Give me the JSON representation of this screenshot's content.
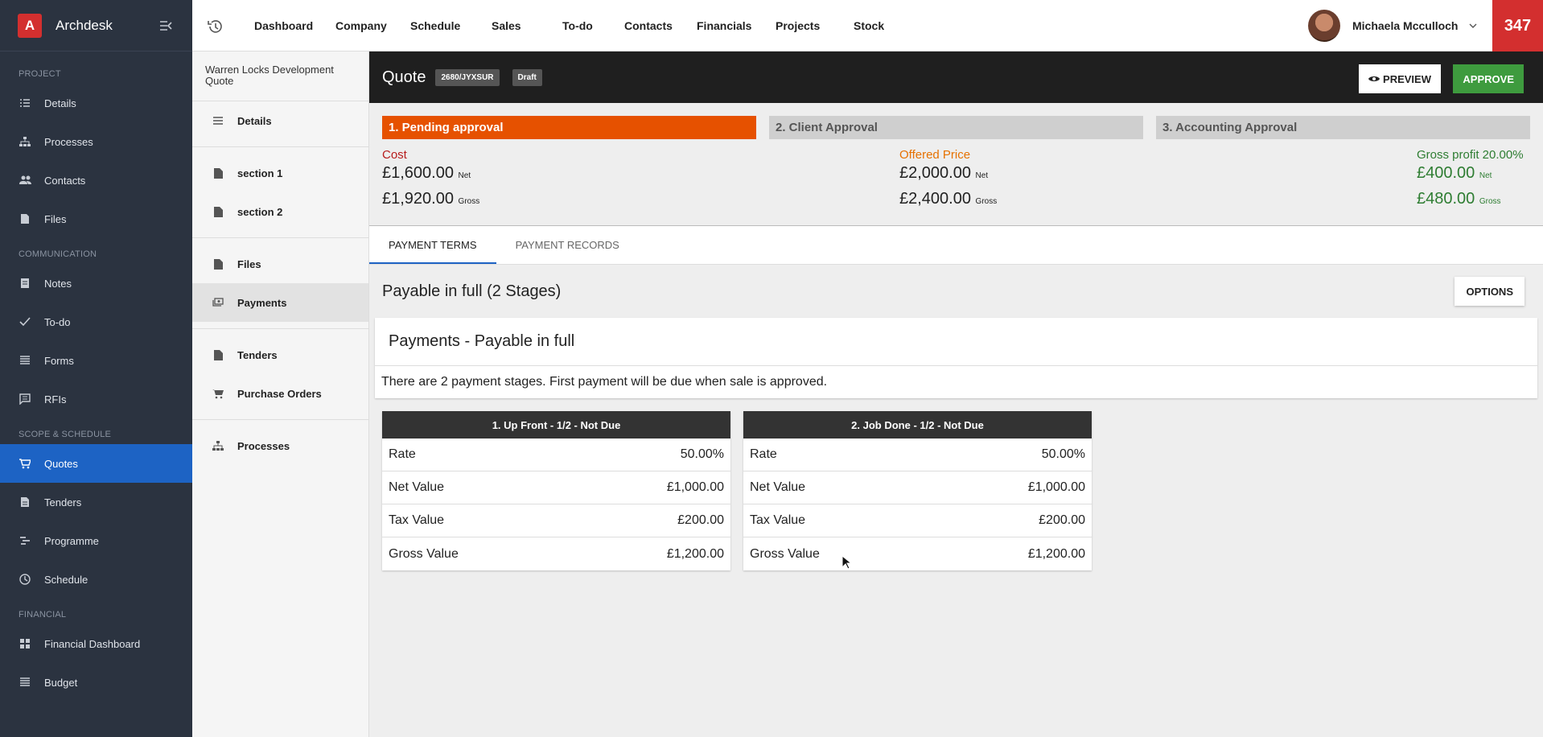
{
  "brand": {
    "logo_letter": "A",
    "name": "Archdesk"
  },
  "sidebar": {
    "sections": [
      {
        "title": "PROJECT",
        "items": [
          {
            "label": "Details",
            "icon": "list-icon"
          },
          {
            "label": "Processes",
            "icon": "hierarchy-icon"
          },
          {
            "label": "Contacts",
            "icon": "people-icon"
          },
          {
            "label": "Files",
            "icon": "file-icon"
          }
        ]
      },
      {
        "title": "COMMUNICATION",
        "items": [
          {
            "label": "Notes",
            "icon": "note-icon"
          },
          {
            "label": "To-do",
            "icon": "check-icon"
          },
          {
            "label": "Forms",
            "icon": "form-icon"
          },
          {
            "label": "RFIs",
            "icon": "rfi-icon"
          }
        ]
      },
      {
        "title": "SCOPE & SCHEDULE",
        "items": [
          {
            "label": "Quotes",
            "icon": "cart-icon",
            "active": true
          },
          {
            "label": "Tenders",
            "icon": "document-icon"
          },
          {
            "label": "Programme",
            "icon": "gantt-icon"
          },
          {
            "label": "Schedule",
            "icon": "clock-icon"
          }
        ]
      },
      {
        "title": "FINANCIAL",
        "items": [
          {
            "label": "Financial Dashboard",
            "icon": "dashboard-icon"
          },
          {
            "label": "Budget",
            "icon": "budget-icon"
          }
        ]
      }
    ]
  },
  "topnav": {
    "items": [
      "Dashboard",
      "Company",
      "Schedule",
      "Sales",
      "To-do",
      "Contacts",
      "Financials",
      "Projects",
      "Stock"
    ],
    "user_name": "Michaela Mcculloch",
    "notification_count": "347"
  },
  "submenu": {
    "title": "Warren Locks Development Quote",
    "items": [
      {
        "label": "Details",
        "icon": "list-icon"
      },
      {
        "label": "section 1",
        "icon": "document-icon"
      },
      {
        "label": "section 2",
        "icon": "document-icon"
      },
      {
        "label": "Files",
        "icon": "file-icon"
      },
      {
        "label": "Payments",
        "icon": "payment-icon",
        "active": true
      },
      {
        "label": "Tenders",
        "icon": "document-icon"
      },
      {
        "label": "Purchase Orders",
        "icon": "cart-icon"
      },
      {
        "label": "Processes",
        "icon": "hierarchy-icon"
      }
    ]
  },
  "quote": {
    "title": "Quote",
    "code": "2680/JYXSUR",
    "status": "Draft",
    "preview_label": "PREVIEW",
    "approve_label": "APPROVE"
  },
  "stages": [
    {
      "label": "1. Pending approval",
      "current": true
    },
    {
      "label": "2. Client Approval",
      "current": false
    },
    {
      "label": "3. Accounting Approval",
      "current": false
    }
  ],
  "totals": {
    "cost": {
      "label": "Cost",
      "net": "£1,600.00",
      "gross": "£1,920.00"
    },
    "offered": {
      "label": "Offered Price",
      "net": "£2,000.00",
      "gross": "£2,400.00"
    },
    "profit": {
      "label": "Gross profit 20.00%",
      "net": "£400.00",
      "gross": "£480.00"
    },
    "net_suffix": "Net",
    "gross_suffix": "Gross"
  },
  "tabs": [
    {
      "label": "PAYMENT TERMS",
      "active": true
    },
    {
      "label": "PAYMENT RECORDS",
      "active": false
    }
  ],
  "plan": {
    "title": "Payable in full (2 Stages)",
    "options_label": "OPTIONS",
    "card_title": "Payments - Payable in full",
    "description": "There are 2 payment stages. First payment will be due when sale is approved."
  },
  "payment_stages": [
    {
      "title": "1. Up Front - 1/2 - Not Due",
      "rows": [
        {
          "label": "Rate",
          "value": "50.00%"
        },
        {
          "label": "Net Value",
          "value": "£1,000.00"
        },
        {
          "label": "Tax Value",
          "value": "£200.00"
        },
        {
          "label": "Gross Value",
          "value": "£1,200.00"
        }
      ]
    },
    {
      "title": "2. Job Done - 1/2 - Not Due",
      "rows": [
        {
          "label": "Rate",
          "value": "50.00%"
        },
        {
          "label": "Net Value",
          "value": "£1,000.00"
        },
        {
          "label": "Tax Value",
          "value": "£200.00"
        },
        {
          "label": "Gross Value",
          "value": "£1,200.00"
        }
      ]
    }
  ]
}
